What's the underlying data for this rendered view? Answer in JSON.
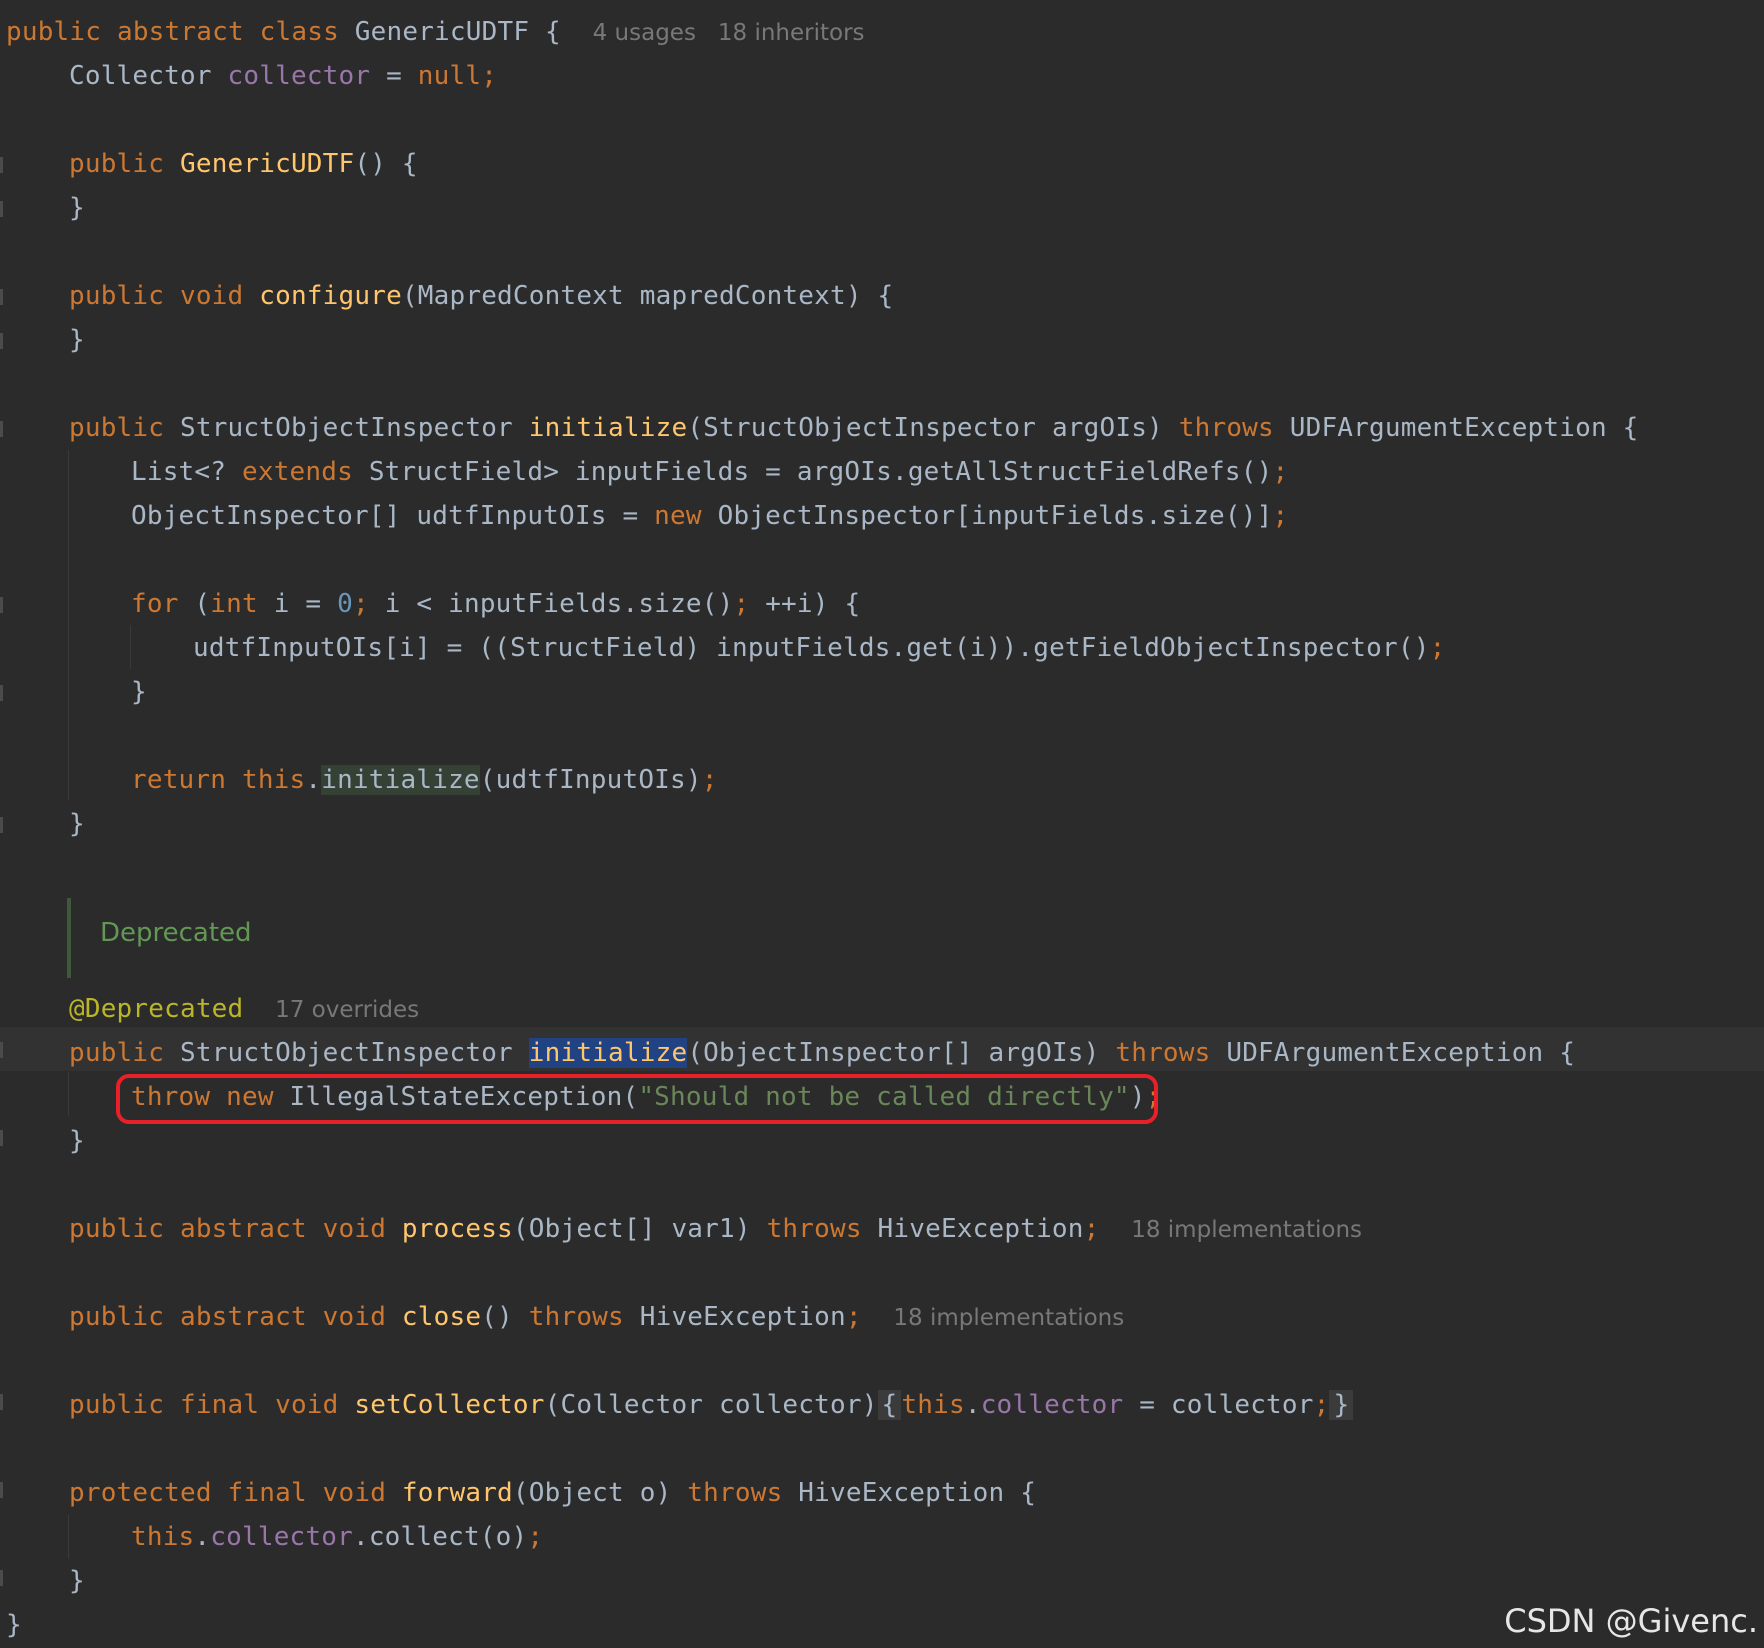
{
  "editor": {
    "class_usages": "4 usages",
    "class_inheritors": "18 inheritors",
    "doc_comment": "Deprecated",
    "deprecated_overrides": "17 overrides",
    "process_hint": "18 implementations",
    "close_hint": "18 implementations",
    "throw_message": "\"Should not be called directly\""
  },
  "code_lines": [
    "public abstract class GenericUDTF {",
    "    Collector collector = null;",
    "",
    "    public GenericUDTF() {",
    "    }",
    "",
    "    public void configure(MapredContext mapredContext) {",
    "    }",
    "",
    "    public StructObjectInspector initialize(StructObjectInspector argOIs) throws UDFArgumentException {",
    "        List<? extends StructField> inputFields = argOIs.getAllStructFieldRefs();",
    "        ObjectInspector[] udtfInputOIs = new ObjectInspector[inputFields.size()];",
    "",
    "        for (int i = 0; i < inputFields.size(); ++i) {",
    "            udtfInputOIs[i] = ((StructField) inputFields.get(i)).getFieldObjectInspector();",
    "        }",
    "",
    "        return this.initialize(udtfInputOIs);",
    "    }",
    "",
    "    @Deprecated",
    "    public StructObjectInspector initialize(ObjectInspector[] argOIs) throws UDFArgumentException {",
    "        throw new IllegalStateException(\"Should not be called directly\");",
    "    }",
    "",
    "    public abstract void process(Object[] var1) throws HiveException;",
    "",
    "    public abstract void close() throws HiveException;",
    "",
    "    public final void setCollector(Collector collector) { this.collector = collector; }",
    "",
    "    protected final void forward(Object o) throws HiveException {",
    "        this.collector.collect(o);",
    "    }",
    "}"
  ],
  "watermark": "CSDN @Givenc."
}
